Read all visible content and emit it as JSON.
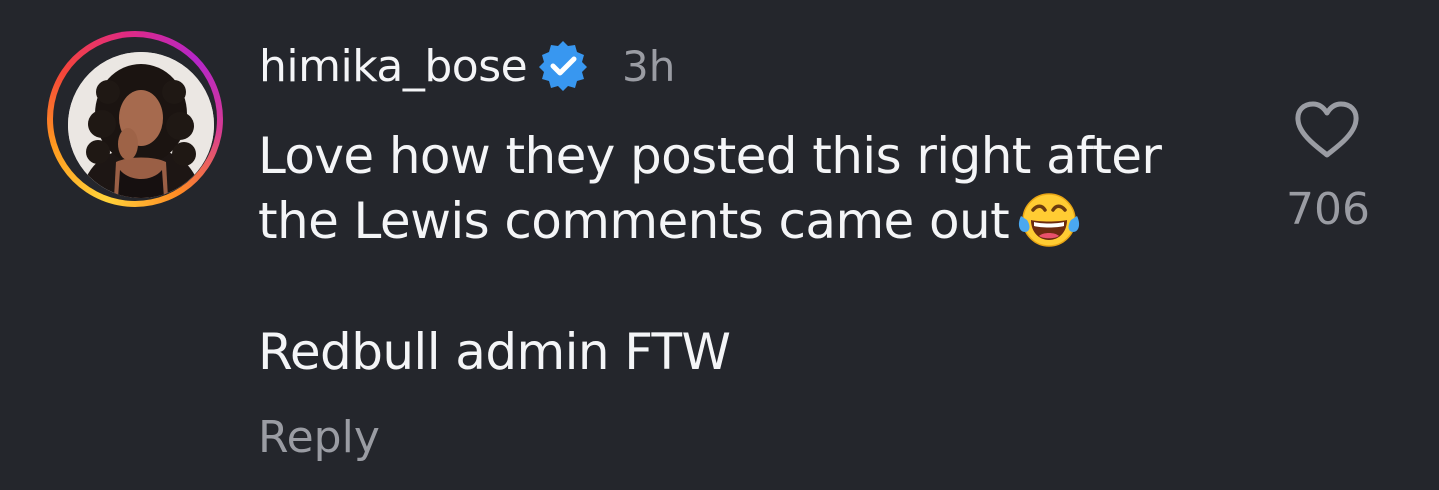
{
  "comment": {
    "username": "himika_bose",
    "verified": true,
    "timestamp": "3h",
    "body_lines": [
      "Love how they posted this right after",
      "the Lewis comments came out"
    ],
    "body_emoji": "face-with-tears-of-joy",
    "second_paragraph": "Redbull admin FTW",
    "reply_label": "Reply",
    "like_count": "706"
  },
  "icons": {
    "verified": "verified-badge-icon",
    "like": "heart-outline-icon",
    "emoji": "face-with-tears-of-joy-icon"
  },
  "colors": {
    "background": "#24262c",
    "text_primary": "#f4f5f7",
    "text_secondary": "#9a9ca3",
    "verified_blue": "#3897f0"
  }
}
